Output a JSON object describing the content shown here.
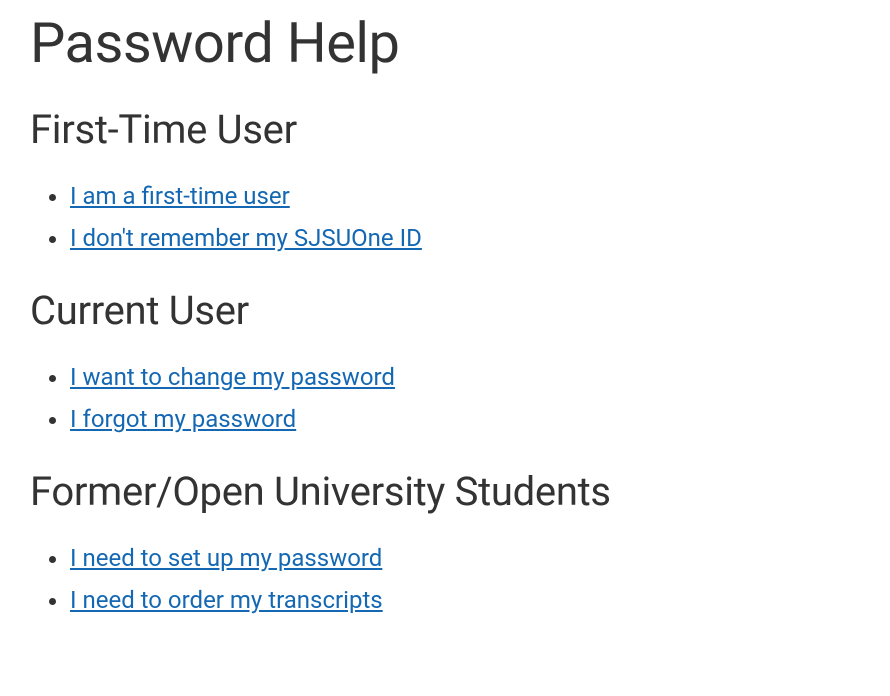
{
  "page": {
    "title": "Password Help"
  },
  "sections": {
    "firstTime": {
      "heading": "First-Time User",
      "links": {
        "0": "I am a first-time user",
        "1": "I don't remember my SJSUOne ID"
      }
    },
    "current": {
      "heading": "Current User",
      "links": {
        "0": "I want to change my password",
        "1": "I forgot my password"
      }
    },
    "former": {
      "heading": "Former/Open University Students",
      "links": {
        "0": "I need to set up my password",
        "1": "I need to order my transcripts"
      }
    }
  }
}
